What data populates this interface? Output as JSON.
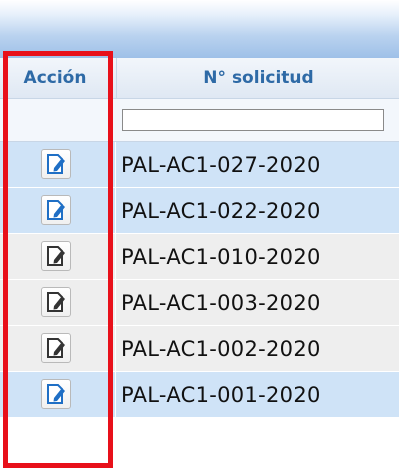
{
  "header": {
    "col_accion": "Acción",
    "col_solicitud": "N° solicitud"
  },
  "filter": {
    "solicitud_value": ""
  },
  "rows": [
    {
      "solicitud": "PAL-AC1-027-2020",
      "state": "blue",
      "icon": "edit-document-icon"
    },
    {
      "solicitud": "PAL-AC1-022-2020",
      "state": "blue",
      "icon": "edit-document-icon"
    },
    {
      "solicitud": "PAL-AC1-010-2020",
      "state": "grey",
      "icon": "edit-document-icon"
    },
    {
      "solicitud": "PAL-AC1-003-2020",
      "state": "grey",
      "icon": "edit-document-icon"
    },
    {
      "solicitud": "PAL-AC1-002-2020",
      "state": "grey",
      "icon": "edit-document-icon"
    },
    {
      "solicitud": "PAL-AC1-001-2020",
      "state": "blue",
      "icon": "edit-document-icon"
    }
  ],
  "colors": {
    "header_text": "#2e6aa6",
    "row_blue": "#cfe3f7",
    "row_grey": "#eeeeee",
    "highlight": "#e8101a",
    "icon_blue": "#1f6fc5",
    "icon_grey": "#333333"
  }
}
